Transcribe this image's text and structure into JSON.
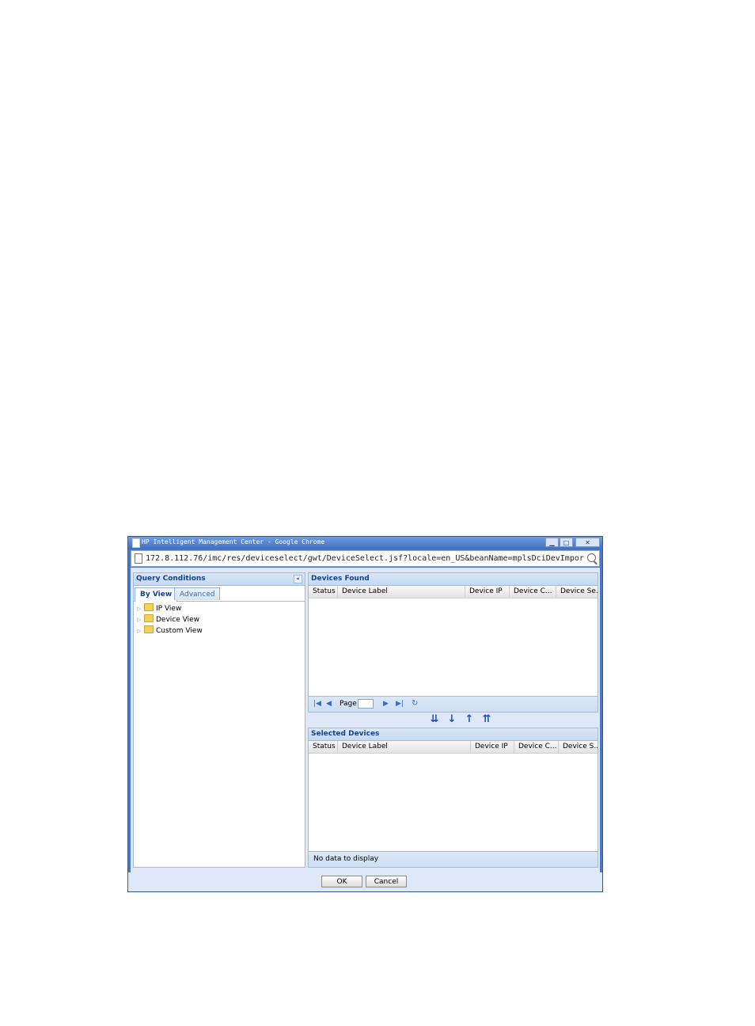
{
  "window": {
    "title": "HP Intelligent Management Center - Google Chrome",
    "min_glyph": "▁",
    "max_glyph": "□",
    "close_glyph": "✕"
  },
  "address_bar": {
    "url": "172.8.112.76/imc/res/deviceselect/gwt/DeviceSelect.jsf?locale=en_US&beanName=mplsDciDevImpor"
  },
  "query_panel": {
    "title": "Query Conditions",
    "collapse_glyph": "«",
    "tabs": [
      {
        "label": "By View",
        "active": true
      },
      {
        "label": "Advanced",
        "active": false
      }
    ],
    "tree": [
      {
        "label": "IP View"
      },
      {
        "label": "Device View"
      },
      {
        "label": "Custom View"
      }
    ]
  },
  "devices_found": {
    "title": "Devices Found",
    "columns": [
      "Status",
      "Device Label",
      "Device IP",
      "Device C...",
      "Device Se..."
    ],
    "pager": {
      "page_label": "Page"
    }
  },
  "move_buttons": {
    "add_all": "⇊",
    "add": "↓",
    "remove": "↑",
    "remove_all": "⇈"
  },
  "selected_devices": {
    "title": "Selected Devices",
    "columns": [
      "Status",
      "Device Label",
      "Device IP",
      "Device C...",
      "Device S..."
    ],
    "status": "No data to display"
  },
  "buttons": {
    "ok": "OK",
    "cancel": "Cancel"
  }
}
